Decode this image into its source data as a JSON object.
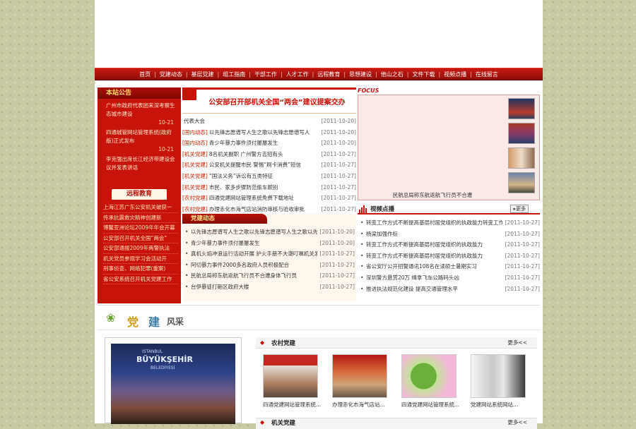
{
  "nav": [
    "首页",
    "党建动态",
    "基层党建",
    "组工指南",
    "干部工作",
    "人才工作",
    "远程教育",
    "思想建设",
    "他山之石",
    "文件下载",
    "视频点播",
    "在线留言"
  ],
  "notice": {
    "title": "本站公告",
    "items": [
      {
        "text": "广州市政府代表团来深考察生态城市建设",
        "date": "10-21"
      },
      {
        "text": "四通城管网站管理系统(政府版)正式发布",
        "date": "10-21"
      },
      {
        "text": "李克强出席长江经济带建设会议并发表讲话",
        "date": ""
      }
    ]
  },
  "remote": {
    "title": "远程教育",
    "items": [
      "上海江苏广东公安机关破获一",
      "传承抗震救灾精神创建新",
      "博鳌亚洲论坛2009年年会开幕",
      "公安部召开机关全国“两会”",
      "公安部通报2009年两警执法",
      "机关党员参观学习会活动开",
      "刑事侦查、网络犯罪(重案)",
      "省公安系统召开机关党建工作"
    ]
  },
  "headline": "公安部召开部机关全国“两会”建议提案交办",
  "news": [
    {
      "cat": "",
      "title": "代表大会",
      "date": "[2011-10-20]"
    },
    {
      "cat": "[国内动态]",
      "title": "以先锋志愿谱写人生之歌以先锋志愿谱写人",
      "date": "[2011-10-20]"
    },
    {
      "cat": "[国内动态]",
      "title": "青少年暴力事件须付屡屡发生",
      "date": "[2011-10-20]"
    },
    {
      "cat": "[机关党建]",
      "title": "8名机关副职 广州警方吉招有头",
      "date": "[2011-10-27]"
    },
    {
      "cat": "[机关党建]",
      "title": "公安机关提醒市民 警惕“刷卡消费”短信",
      "date": "[2011-10-27]"
    },
    {
      "cat": "[机关党建]",
      "title": "“国法义务”诉讼有五类特征",
      "date": "[2011-10-27]"
    },
    {
      "cat": "[机关党建]",
      "title": "市民、家多步骤防范偷车顾别",
      "date": "[2011-10-27]"
    },
    {
      "cat": "[农村党建]",
      "title": "四通党建网站管理系统免费下载地址",
      "date": "[2011-10-27]"
    },
    {
      "cat": "[农村党建]",
      "title": "办理赤化市海气店站消防审核与验收审批",
      "date": "[2011-10-27]"
    }
  ],
  "party": {
    "title": "党建动态",
    "items": [
      {
        "title": "以先锋志愿谱写人生之歌以先锋志愿谱写人生之歌以先锋志愿",
        "date": "[2011-10-20]"
      },
      {
        "title": "青少年暴力事件须付屡屡发生",
        "date": "[2011-10-20]"
      },
      {
        "title": "真机火焰冲浪运行活动开展 护火手册不大潮叮嘱机关发布",
        "date": "[2011-10-27]"
      },
      {
        "title": "阿切暴力事件2000多名政府人员积极配合",
        "date": "[2011-10-27]"
      },
      {
        "title": "民航总局称东航返航飞行员不合遭身体飞行员",
        "date": "[2011-10-27]"
      },
      {
        "title": "台伊暴徒打砸区政府大楼",
        "date": "[2011-10-27]"
      }
    ]
  },
  "focus": {
    "label": "FOCUS",
    "caption": "民航总局称东航返航飞行员不合遭"
  },
  "video": {
    "title": "视频点播",
    "more": "更多",
    "items": [
      {
        "title": "转变工作方式不断提高基层村居党组织的执政能力转变工作",
        "date": "[2011-10-27]"
      },
      {
        "title": "杨梁加强作标",
        "date": "[2011-10-27]"
      },
      {
        "title": "转变工作方式不断提高基层村居党组织的执政能力",
        "date": "[2011-10-27]"
      },
      {
        "title": "转变工作方式不断提高基层村居党组织的执政能力",
        "date": "[2011-10-27]"
      },
      {
        "title": "省公安厅公开招警通讯108名在读硕士暑期实习",
        "date": "[2011-10-27]"
      },
      {
        "title": "深圳警方悬赏20万 缉拿飞车公路码头凶",
        "date": "[2011-10-27]"
      },
      {
        "title": "推进执法规范化建设 提高交通管理水平",
        "date": "[2011-10-27]"
      }
    ]
  },
  "style_banner": {
    "a": "党",
    "b": "建",
    "c": "风采"
  },
  "big_photo": {
    "line1": "ISTANBUL",
    "line2": "BÜYÜKŞEHİR",
    "line3": "BELEDİYESİ"
  },
  "rural": {
    "title": "农村党建",
    "more": "更多<<",
    "items": [
      "四通党建网站管理系统...",
      "办理赤化市海气店站...",
      "四通党建网站管理系统...",
      "党建网站系统网站..."
    ]
  },
  "jiguan": {
    "title": "机关党建",
    "more": "更多<<"
  }
}
